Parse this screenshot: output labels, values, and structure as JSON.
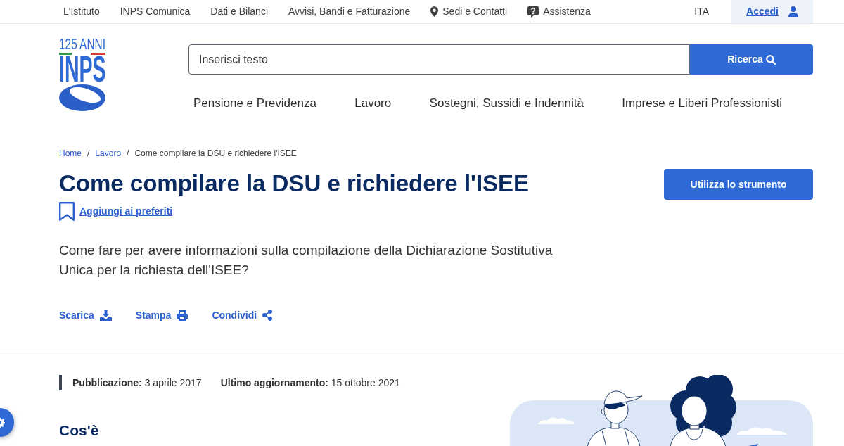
{
  "top_bar": {
    "links": [
      {
        "label": "L'Istituto",
        "kind": "text"
      },
      {
        "label": "INPS Comunica",
        "kind": "text"
      },
      {
        "label": "Dati e Bilanci",
        "kind": "text"
      },
      {
        "label": "Avvisi, Bandi e Fatturazione",
        "kind": "text"
      },
      {
        "label": "Sedi e Contatti",
        "kind": "icon_text"
      },
      {
        "label": "Assistenza",
        "kind": "icon_text"
      }
    ],
    "language": "ITA",
    "login": "Accedi"
  },
  "logo": {
    "badge": "125 ANNI",
    "name": "INPS"
  },
  "search": {
    "placeholder": "Inserisci testo",
    "button": "Ricerca"
  },
  "main_nav": [
    {
      "label": "Pensione e Previdenza"
    },
    {
      "label": "Lavoro"
    },
    {
      "label": "Sostegni, Sussidi e Indennità"
    },
    {
      "label": "Imprese e Liberi Professionisti"
    }
  ],
  "breadcrumb": [
    {
      "label": "Home",
      "kind": "link"
    },
    {
      "label": "Lavoro",
      "kind": "link",
      "separator": "/"
    },
    {
      "label": "Come compilare la DSU e richiedere l'ISEE",
      "kind": "current",
      "separator": "/"
    }
  ],
  "page": {
    "title": "Come compilare la DSU e richiedere l'ISEE",
    "favorite": "Aggiungi ai preferiti",
    "tool_button": "Utilizza lo strumento",
    "description": "Come fare per avere informazioni sulla compilazione della Dichiarazione Sostitutiva Unica per la richiesta dell'ISEE?",
    "actions": [
      {
        "label": "Scarica"
      },
      {
        "label": "Stampa"
      },
      {
        "label": "Condividi"
      }
    ]
  },
  "meta": [
    "**Pubblicazione:** 3 aprile 2017",
    "**Ultimo aggiornamento:** 15 ottobre 2021"
  ],
  "section": {
    "heading": "Cos'è"
  }
}
